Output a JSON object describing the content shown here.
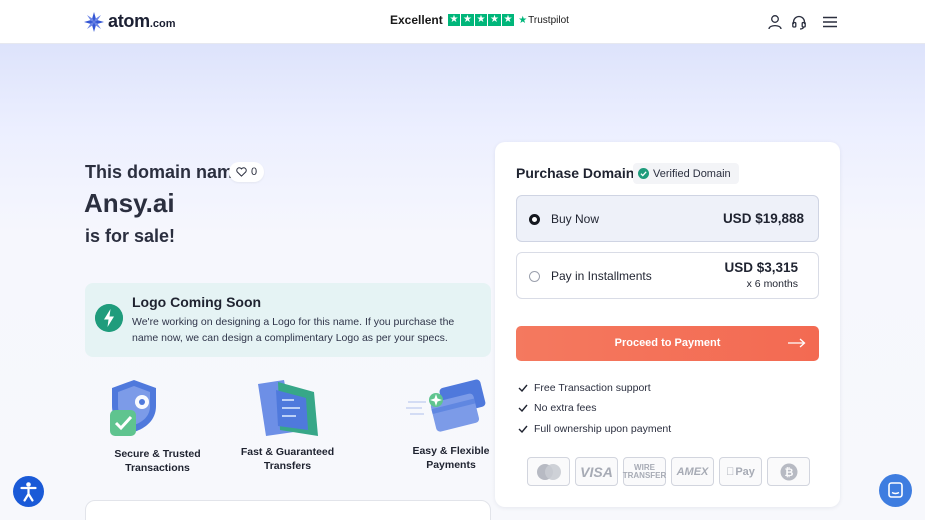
{
  "header": {
    "logo_text": "atom",
    "logo_suffix": ".com",
    "trustpilot_rating": "Excellent",
    "trustpilot_brand": "Trustpilot",
    "icons": [
      "user-icon",
      "headset-icon",
      "menu-icon"
    ]
  },
  "listing": {
    "label": "This domain name",
    "likes": "0",
    "domain": "Ansy.ai",
    "status": "is for sale!"
  },
  "logo_notice": {
    "title": "Logo Coming Soon",
    "body": "We're working on designing a Logo for this name. If you purchase the name now, we can design a complimentary Logo as per your specs."
  },
  "features": [
    {
      "label": "Secure & Trusted Transactions"
    },
    {
      "label": "Fast & Guaranteed Transfers"
    },
    {
      "label": "Easy & Flexible Payments"
    }
  ],
  "purchase": {
    "title": "Purchase Domain",
    "verified": "Verified Domain",
    "options": [
      {
        "label": "Buy Now",
        "price": "USD $19,888",
        "selected": true
      },
      {
        "label": "Pay in Installments",
        "price": "USD $3,315",
        "sub": "x 6 months",
        "selected": false
      }
    ],
    "cta": "Proceed to Payment",
    "benefits": [
      "Free Transaction support",
      "No extra fees",
      "Full ownership upon payment"
    ],
    "payment_methods": [
      "mastercard-icon",
      "VISA",
      "WIRE TRANSFER",
      "AMEX",
      "Pay",
      "bitcoin-icon"
    ]
  },
  "colors": {
    "accent": "#f36a52",
    "brand": "#2b4fd1",
    "success": "#1f9c7c",
    "trustpilot": "#00b67a"
  }
}
